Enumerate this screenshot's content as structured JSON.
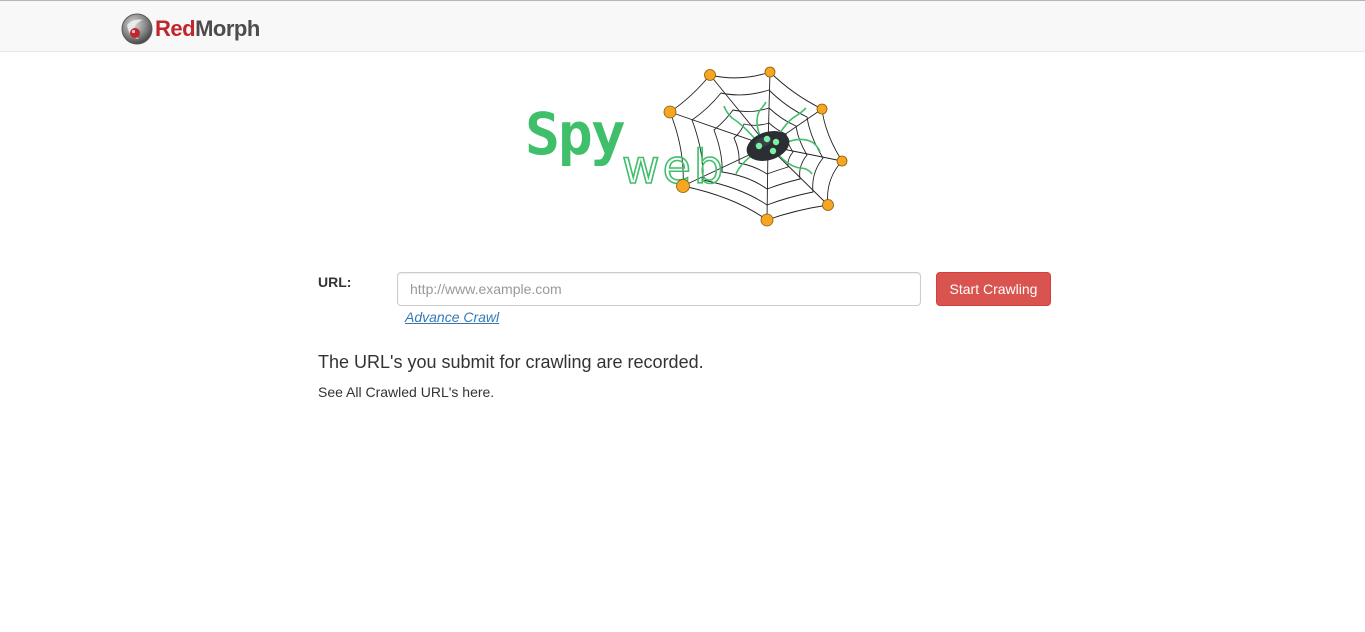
{
  "navbar": {
    "brand_red": "Red",
    "brand_gray": "Morph"
  },
  "logo": {
    "word_top": "Spy",
    "word_bottom": "web",
    "text_color": "#3fbf6a",
    "node_color": "#f5a623"
  },
  "form": {
    "url_label": "URL:",
    "url_placeholder": "http://www.example.com",
    "url_value": "",
    "submit_label": "Start Crawling",
    "advance_link": "Advance Crawl"
  },
  "notice": {
    "heading": "The URL's you submit for crawling are recorded.",
    "subtext": "See All Crawled URL's here."
  },
  "colors": {
    "accent_button": "#d9534f",
    "link": "#337ab7",
    "navbar_bg": "#f8f8f8"
  }
}
